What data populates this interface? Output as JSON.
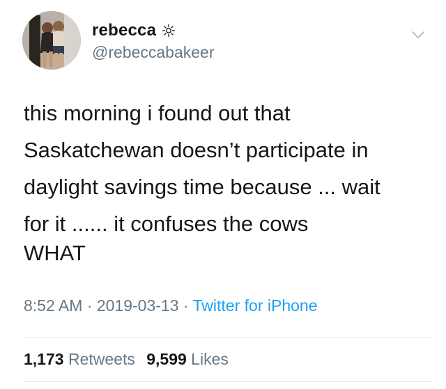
{
  "user": {
    "display_name": "rebecca",
    "name_emoji_icon": "sun-icon",
    "handle": "@rebeccabakeer",
    "avatar_icon": "profile-photo"
  },
  "tweet": {
    "lines": [
      "this morning i found out that",
      "Saskatchewan doesn’t participate in",
      "daylight savings time because ... wait",
      "for it ...... it confuses the cows"
    ],
    "shout": "WHAT"
  },
  "meta": {
    "time": "8:52 AM",
    "separator": " · ",
    "date": "2019-03-13",
    "source": "Twitter for iPhone"
  },
  "stats": {
    "retweets_count": "1,173",
    "retweets_label": "Retweets",
    "likes_count": "9,599",
    "likes_label": "Likes"
  },
  "colors": {
    "text": "#14171a",
    "secondary": "#657786",
    "link": "#1da1f2",
    "divider": "#e1e8ed"
  },
  "menu": {
    "icon": "chevron-down-icon"
  }
}
